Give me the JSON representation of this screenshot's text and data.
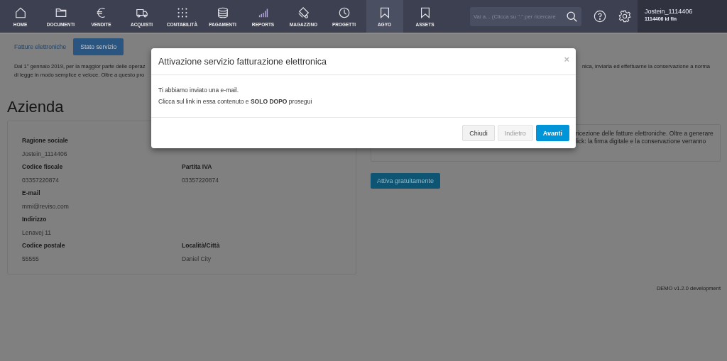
{
  "nav": {
    "items": [
      {
        "label": "HOME",
        "selected": false
      },
      {
        "label": "DOCUMENTI",
        "selected": false
      },
      {
        "label": "VENDITE",
        "selected": false
      },
      {
        "label": "ACQUISTI",
        "selected": false
      },
      {
        "label": "CONTABILITÀ",
        "selected": false
      },
      {
        "label": "PAGAMENTI",
        "selected": false
      },
      {
        "label": "REPORTS",
        "selected": false
      },
      {
        "label": "MAGAZZINO",
        "selected": false
      },
      {
        "label": "PROGETTI",
        "selected": false
      },
      {
        "label": "AGYO",
        "selected": true
      },
      {
        "label": "ASSETS",
        "selected": false
      }
    ],
    "search": {
      "placeholder": "Vai a... (Clicca su \".\" per ricercare"
    },
    "user": {
      "name": "Jostein_1114406",
      "id": "1114406 id fin"
    }
  },
  "tabs": [
    {
      "label": "Fatture elettroniche",
      "selected": false
    },
    {
      "label": "Stato servizio",
      "selected": true
    }
  ],
  "intro": [
    {
      "start": "Dal 1° gennaio 2019, per la maggior parte delle operaz",
      "end": "nica, inviarla ed effettuarne la conservazione a norma"
    },
    {
      "start": "di legge in modo semplice e veloce. Oltre a questo pro"
    }
  ],
  "heading": "Azienda",
  "company": {
    "rows": [
      {
        "fields": [
          {
            "label": "Ragione sociale",
            "value": "Jostein_1114406"
          }
        ]
      },
      {
        "fields": [
          {
            "label": "Codice fiscale",
            "value": "03357220874"
          },
          {
            "label": "Partita IVA",
            "value": "03357220874"
          }
        ]
      },
      {
        "fields": [
          {
            "label": "E-mail",
            "value": "mmi@reviso.com"
          }
        ]
      },
      {
        "fields": [
          {
            "label": "Indirizzo",
            "value": "Lenavej 11"
          }
        ]
      },
      {
        "fields": [
          {
            "label": "Codice postale",
            "value": "55555"
          },
          {
            "label": "Località/Città",
            "value": "Daniel City"
          }
        ]
      }
    ]
  },
  "service": {
    "lines": [
      "ricezione delle fatture elettroniche. Oltre a generare",
      "lick: la firma digitale e la conservazione verranno"
    ],
    "button": "Attiva gratuitamente"
  },
  "modal": {
    "title": "Attivazione servizio fatturazione elettronica",
    "close": "×",
    "body": [
      "Ti abbiamo inviato una e-mail.",
      "Clicca sul link in essa contenuto e **SOLO DOPO** prosegui"
    ],
    "buttons": [
      {
        "label": "Chiudi",
        "kind": "default",
        "disabled": false
      },
      {
        "label": "Indietro",
        "kind": "default",
        "disabled": true
      },
      {
        "label": "Avanti",
        "kind": "primary",
        "disabled": false
      }
    ]
  },
  "footer": "DEMO v1.2.0 development"
}
